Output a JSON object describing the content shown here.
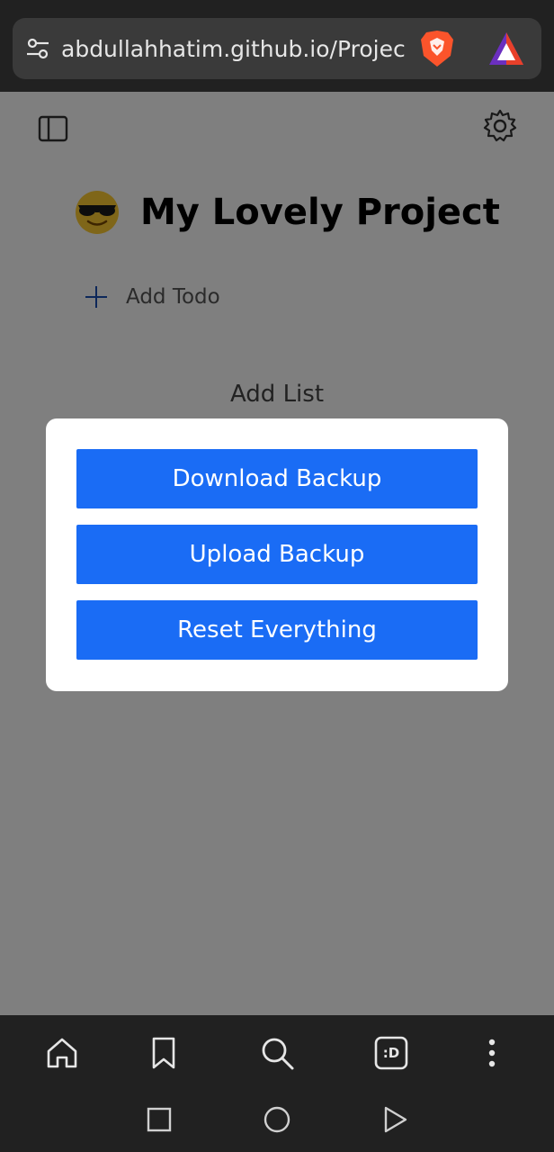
{
  "browser": {
    "url": "abdullahhatim.github.io/Projec",
    "toolbar_icons": [
      "home-icon",
      "bookmark-icon",
      "search-icon",
      "tab-switcher-icon",
      "more-vertical-icon"
    ],
    "tab_switcher_label": ":D",
    "system_nav_icons": [
      "recents-square-icon",
      "home-circle-icon",
      "back-triangle-icon"
    ]
  },
  "page": {
    "project_emoji": "😎",
    "project_title": "My Lovely Project",
    "add_todo_label": "Add Todo",
    "add_list_label": "Add List"
  },
  "modal": {
    "download_label": "Download Backup",
    "upload_label": "Upload Backup",
    "reset_label": "Reset Everything"
  },
  "colors": {
    "accent": "#1a6cf5",
    "overlay": "rgba(0,0,0,0.5)",
    "browser_chrome": "#212121"
  }
}
